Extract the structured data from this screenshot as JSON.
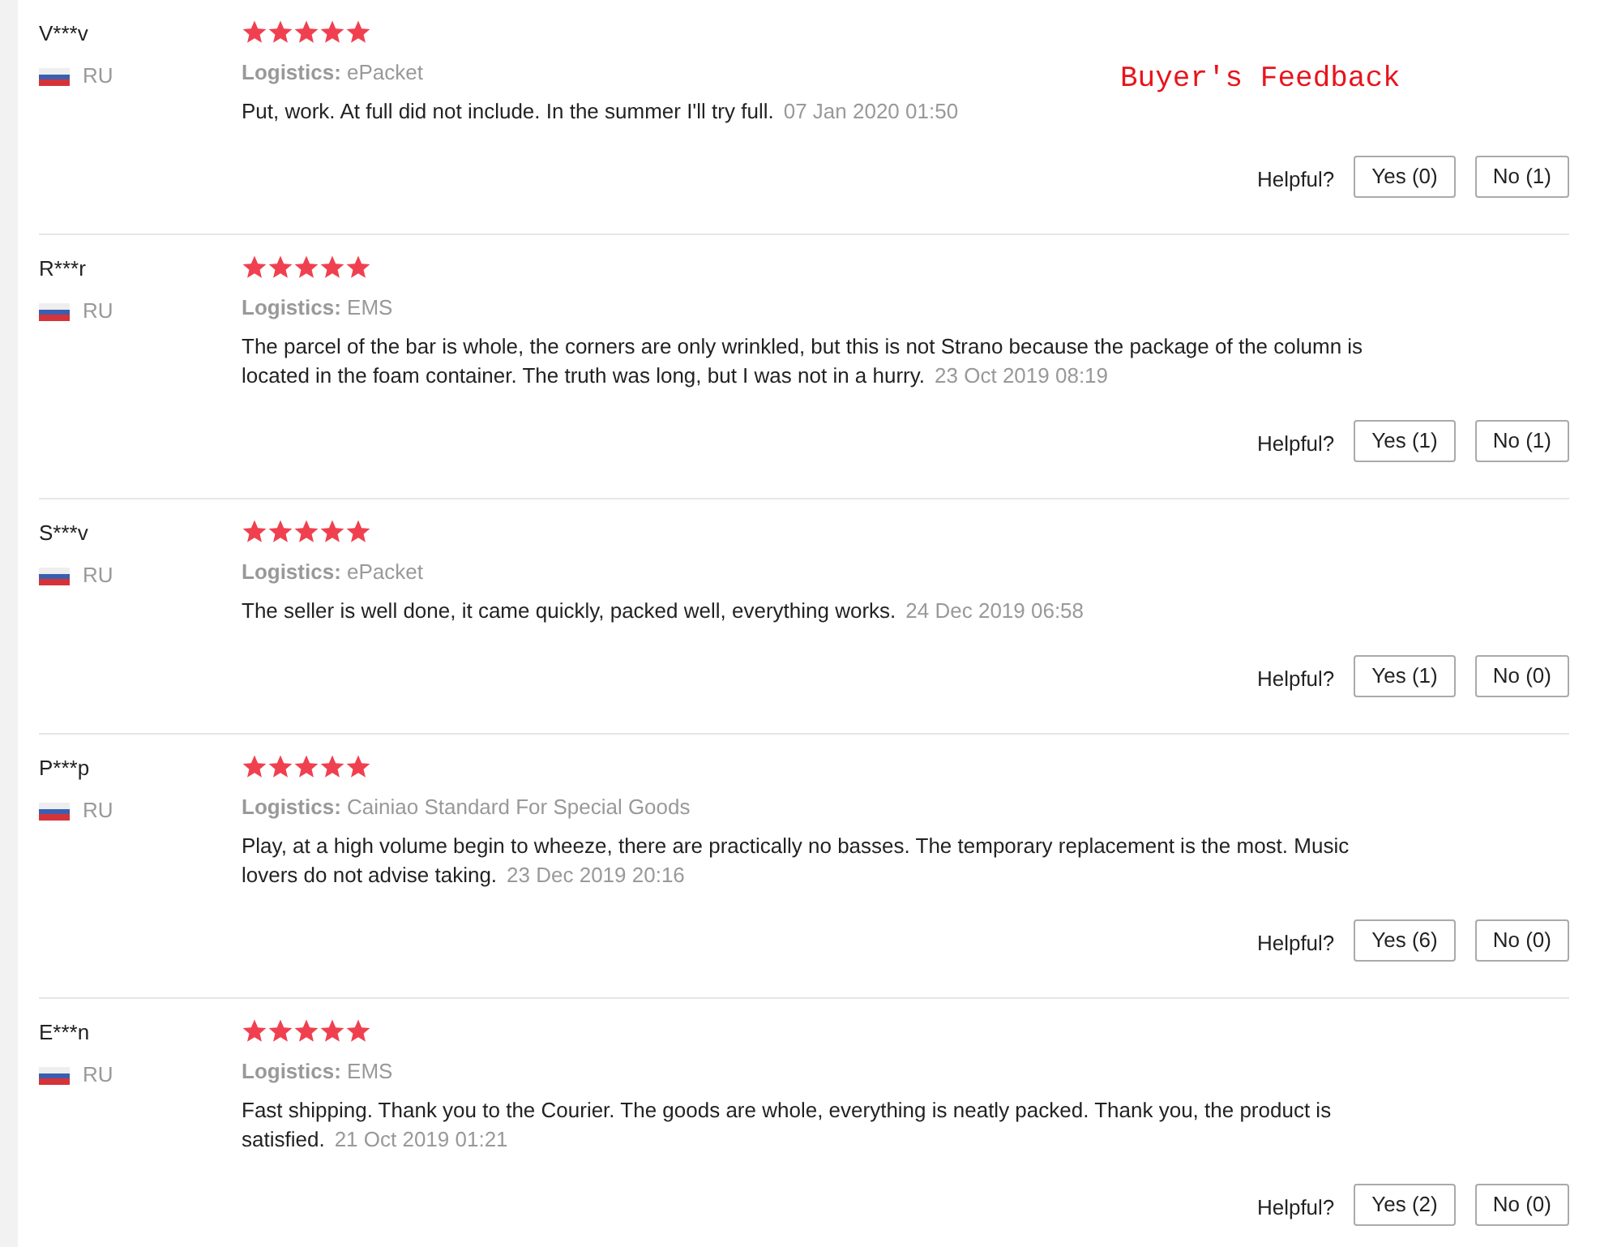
{
  "annotation": "Buyer's Feedback",
  "reviews": [
    {
      "buyer": "V***v",
      "country": "RU",
      "stars": 5,
      "logistics_label": "Logistics:",
      "logistics": "ePacket",
      "text": "Put, work. At full did not include. In the summer I'll try full.",
      "date": "07 Jan 2020 01:50",
      "helpful_label": "Helpful?",
      "yes": "Yes (0)",
      "no": "No (1)"
    },
    {
      "buyer": "R***r",
      "country": "RU",
      "stars": 5,
      "logistics_label": "Logistics:",
      "logistics": "EMS",
      "text": "The parcel of the bar is whole, the corners are only wrinkled, but this is not Strano because the package of the column is located in the foam container. The truth was long, but I was not in a hurry.",
      "date": "23 Oct 2019 08:19",
      "helpful_label": "Helpful?",
      "yes": "Yes (1)",
      "no": "No (1)"
    },
    {
      "buyer": "S***v",
      "country": "RU",
      "stars": 5,
      "logistics_label": "Logistics:",
      "logistics": "ePacket",
      "text": "The seller is well done, it came quickly, packed well, everything works.",
      "date": "24 Dec 2019 06:58",
      "helpful_label": "Helpful?",
      "yes": "Yes (1)",
      "no": "No (0)"
    },
    {
      "buyer": "P***p",
      "country": "RU",
      "stars": 5,
      "logistics_label": "Logistics:",
      "logistics": "Cainiao Standard For Special Goods",
      "text": "Play, at a high volume begin to wheeze, there are practically no basses. The temporary replacement is the most. Music lovers do not advise taking.",
      "date": "23 Dec 2019 20:16",
      "helpful_label": "Helpful?",
      "yes": "Yes (6)",
      "no": "No (0)"
    },
    {
      "buyer": "E***n",
      "country": "RU",
      "stars": 5,
      "logistics_label": "Logistics:",
      "logistics": "EMS",
      "text": "Fast shipping. Thank you to the Courier. The goods are whole, everything is neatly packed. Thank you, the product is satisfied.",
      "date": "21 Oct 2019 01:21",
      "helpful_label": "Helpful?",
      "yes": "Yes (2)",
      "no": "No (0)"
    }
  ]
}
